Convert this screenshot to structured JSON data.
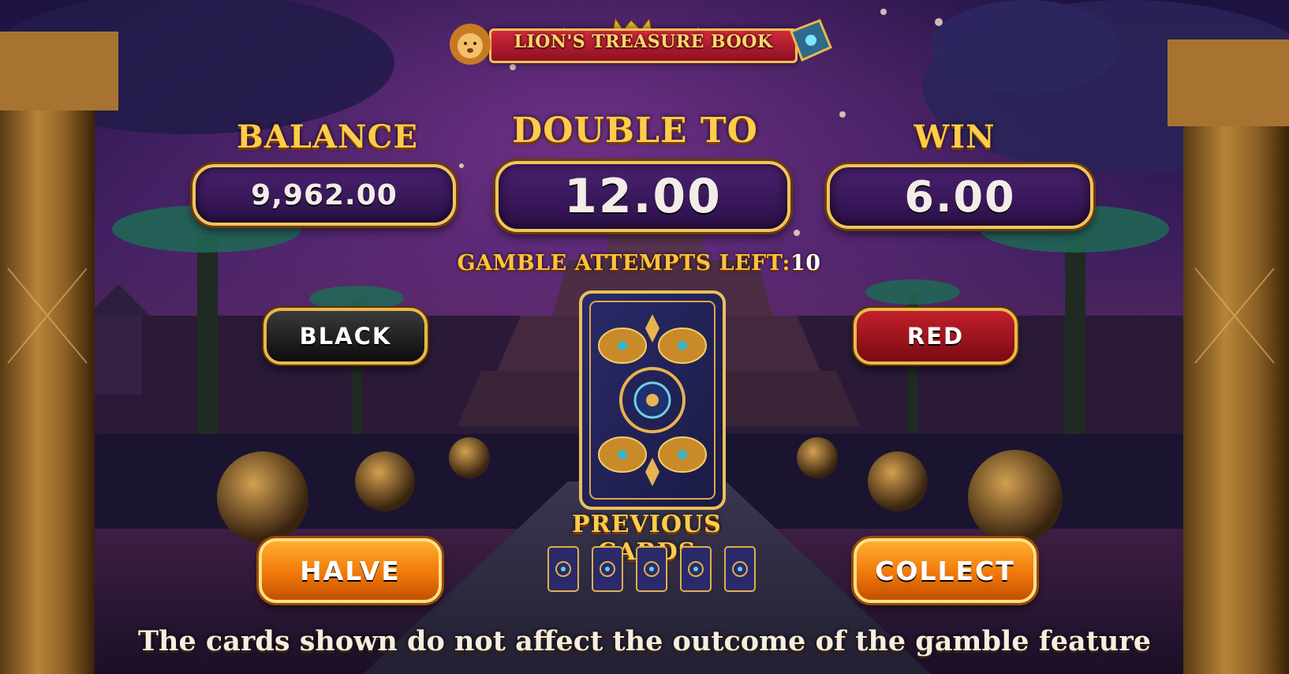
{
  "game": {
    "title": "LION'S TREASURE BOOK"
  },
  "panels": {
    "balance": {
      "label": "BALANCE",
      "value": "9,962.00"
    },
    "double_to": {
      "label": "DOUBLE TO",
      "value": "12.00"
    },
    "win": {
      "label": "WIN",
      "value": "6.00"
    }
  },
  "gamble": {
    "attempts_label": "GAMBLE ATTEMPTS LEFT:",
    "attempts_value": "10",
    "previous_cards_label": "PREVIOUS CARDS",
    "previous_cards_count": 5
  },
  "buttons": {
    "black": "BLACK",
    "red": "RED",
    "halve": "HALVE",
    "collect": "COLLECT"
  },
  "disclaimer": "The cards shown do not affect the outcome of the gamble feature",
  "colors": {
    "gold": "#ffcc4a",
    "panel_bg": "#3a1760",
    "button_orange": "#f0780a",
    "button_red": "#b01a24",
    "button_black": "#1a1a1a"
  }
}
